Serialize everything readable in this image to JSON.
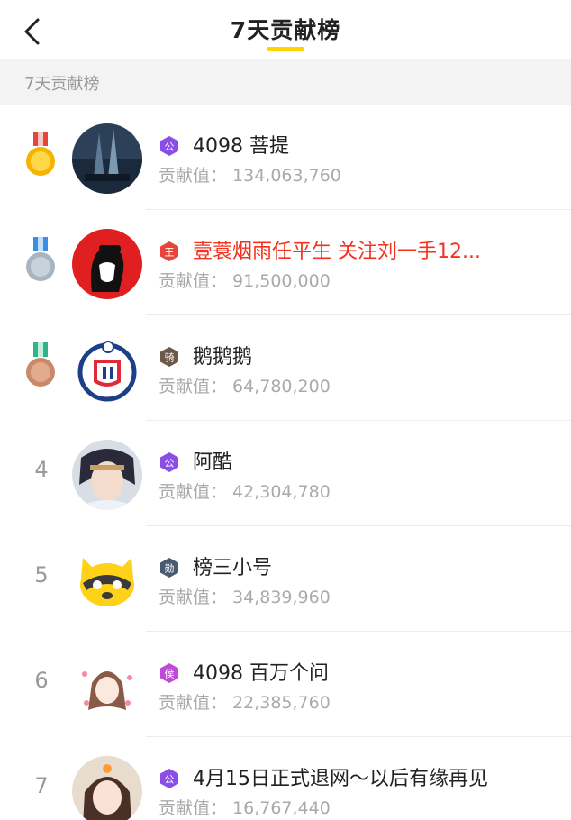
{
  "header": {
    "title": "7天贡献榜",
    "back_icon": "chevron-left-icon"
  },
  "section": {
    "label": "7天贡献榜"
  },
  "colors": {
    "accent": "#ffd400",
    "highlight_name": "#f5311f",
    "gold": "#f5b400",
    "silver": "#a8b4c0",
    "bronze": "#c98a6a"
  },
  "contrib_label": "贡献值：",
  "rows": [
    {
      "rank": "1",
      "medal": "gold",
      "badge": "公",
      "badge_color": "#8a4ee6",
      "name": "4098 菩提",
      "value": "134,063,760",
      "name_red": false
    },
    {
      "rank": "2",
      "medal": "silver",
      "badge": "王",
      "badge_color": "#e8443a",
      "name": "壹蓑烟雨任平生 关注刘一手12...",
      "value": "91,500,000",
      "name_red": true
    },
    {
      "rank": "3",
      "medal": "bronze",
      "badge": "骑",
      "badge_color": "#6b5a4a",
      "name": "鹅鹅鹅",
      "value": "64,780,200",
      "name_red": false
    },
    {
      "rank": "4",
      "medal": "",
      "badge": "公",
      "badge_color": "#8a4ee6",
      "name": "阿酷",
      "value": "42,304,780",
      "name_red": false
    },
    {
      "rank": "5",
      "medal": "",
      "badge": "勋",
      "badge_color": "#4a5a70",
      "name": "榜三小号",
      "value": "34,839,960",
      "name_red": false
    },
    {
      "rank": "6",
      "medal": "",
      "badge": "侯",
      "badge_color": "#c04ad8",
      "name": "4098 百万个问",
      "value": "22,385,760",
      "name_red": false
    },
    {
      "rank": "7",
      "medal": "",
      "badge": "公",
      "badge_color": "#8a4ee6",
      "name": "4月15日正式退网～以后有缘再见",
      "value": "16,767,440",
      "name_red": false
    }
  ]
}
